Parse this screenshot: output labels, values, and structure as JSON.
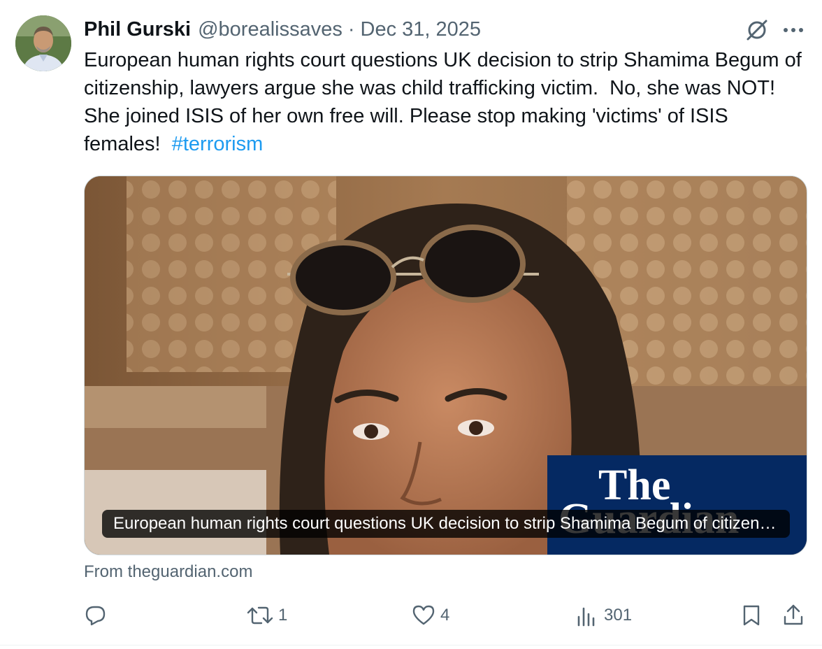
{
  "post": {
    "author_name": "Phil Gurski",
    "author_handle": "@borealissaves",
    "separator": "·",
    "date": "Dec 31, 2025",
    "text": "European human rights court questions UK decision to strip Shamima Begum of citizenship, lawyers argue she was child trafficking victim.  No, she was NOT!  She joined ISIS of her own free will. Please stop making 'victims' of ISIS females!  ",
    "hashtag": "#terrorism"
  },
  "card": {
    "caption": "European human rights court questions UK decision to strip Shamima Begum of citizenship, lawyers argue she was child trafficking victim",
    "logo_text": [
      "The",
      "Guardian"
    ],
    "source": "From theguardian.com"
  },
  "actions": {
    "reply_count": "",
    "repost_count": "1",
    "like_count": "4",
    "views_count": "301"
  },
  "icons": {
    "grok": "grok-icon",
    "more": "more-icon",
    "reply": "reply-icon",
    "repost": "repost-icon",
    "like": "heart-icon",
    "views": "views-icon",
    "bookmark": "bookmark-icon",
    "share": "share-icon"
  },
  "colors": {
    "text": "#0f1419",
    "secondary": "#536471",
    "link": "#1d9bf0",
    "guardian_blue": "#052962"
  }
}
